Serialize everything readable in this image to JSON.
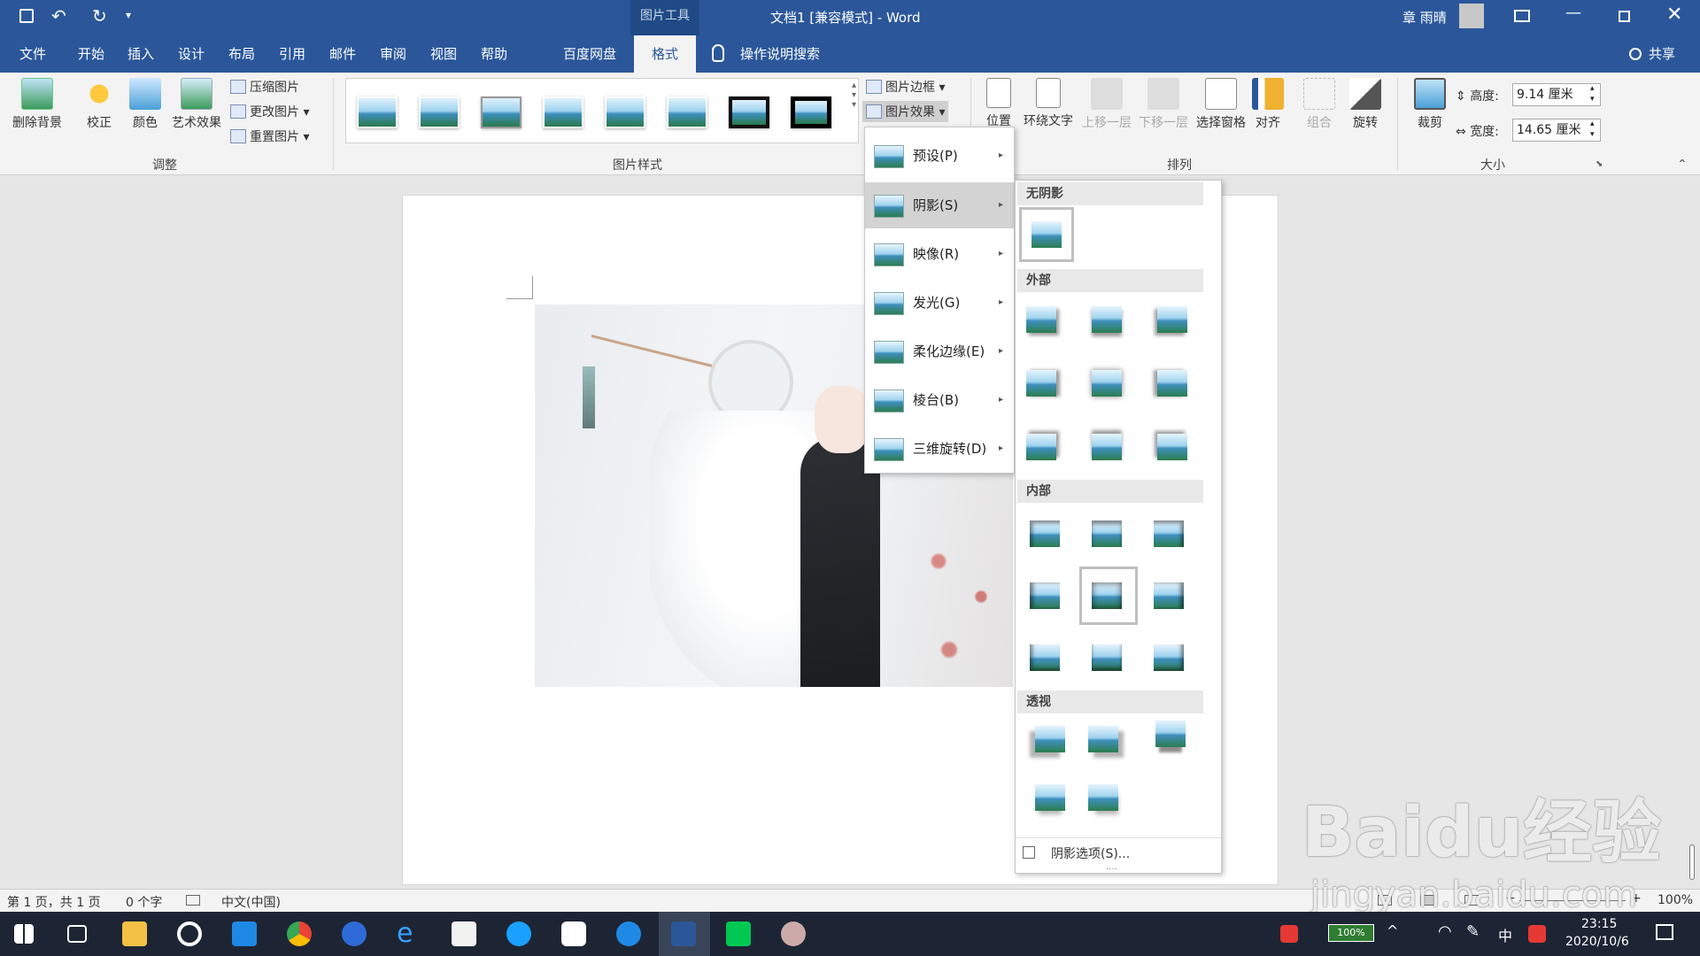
{
  "titlebar": {
    "context_tab": "图片工具",
    "title": "文档1 [兼容模式]  -  Word",
    "user": "章 雨晴"
  },
  "menu": [
    "文件",
    "开始",
    "插入",
    "设计",
    "布局",
    "引用",
    "邮件",
    "审阅",
    "视图",
    "帮助",
    "百度网盘",
    "格式"
  ],
  "search": "操作说明搜索",
  "share": "共享",
  "ribbon": {
    "adjust": {
      "remove_bg": "删除背景",
      "correct": "校正",
      "color": "颜色",
      "artistic": "艺术效果",
      "compress": "压缩图片",
      "change": "更改图片",
      "reset": "重置图片",
      "label": "调整"
    },
    "styles_label": "图片样式",
    "border": "图片边框",
    "effects": "图片效果",
    "arrange": {
      "position": "位置",
      "wrap": "环绕文字",
      "forward": "上移一层",
      "backward": "下移一层",
      "pane": "选择窗格",
      "align": "对齐",
      "group": "组合",
      "rotate": "旋转",
      "label": "排列"
    },
    "size": {
      "crop": "裁剪",
      "height_label": "高度:",
      "height": "9.14 厘米",
      "width_label": "宽度:",
      "width": "14.65 厘米",
      "label": "大小"
    }
  },
  "effects_menu": [
    "预设(P)",
    "阴影(S)",
    "映像(R)",
    "发光(G)",
    "柔化边缘(E)",
    "棱台(B)",
    "三维旋转(D)"
  ],
  "shadow_panel": {
    "none": "无阴影",
    "outer": "外部",
    "inner": "内部",
    "perspective": "透视",
    "options": "阴影选项(S)..."
  },
  "status": {
    "page": "第 1 页，共 1 页",
    "words": "0 个字",
    "lang": "中文(中国)",
    "zoom": "100%"
  },
  "taskbar": {
    "battery": "100%",
    "ime": "中",
    "time": "23:15",
    "date": "2020/10/6"
  },
  "watermark": {
    "brand": "Baidu经验",
    "url": "jingyan.baidu.com"
  }
}
